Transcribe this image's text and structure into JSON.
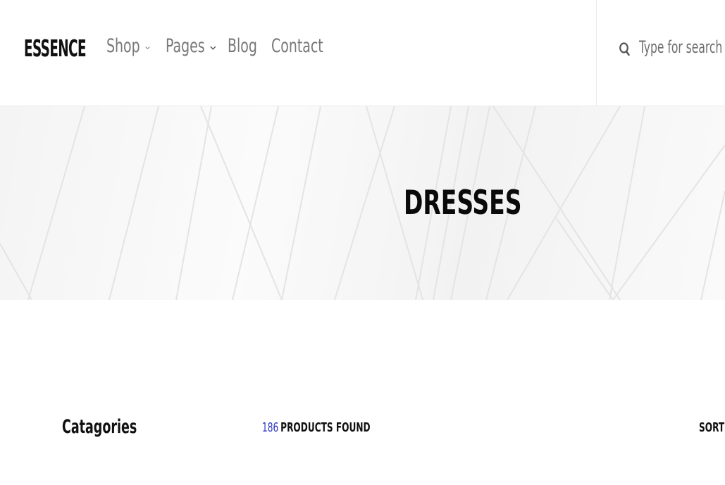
{
  "header": {
    "logo": "ESSENCE",
    "nav": [
      {
        "label": "Shop",
        "has_dropdown": true
      },
      {
        "label": "Pages",
        "has_dropdown": true
      },
      {
        "label": "Blog",
        "has_dropdown": false
      },
      {
        "label": "Contact",
        "has_dropdown": false
      }
    ],
    "search": {
      "placeholder": "Type for search",
      "value": "",
      "icon": "search-icon"
    }
  },
  "hero": {
    "title": "DRESSES"
  },
  "content": {
    "categories_title": "Catagories",
    "products_count": "186",
    "products_found_label": "PRODUCTS FOUND",
    "sort_label": "SORT"
  },
  "colors": {
    "accent": "#2d34c6",
    "text": "#111111",
    "nav": "#787878",
    "hero_bg": "#f4f4f4"
  }
}
